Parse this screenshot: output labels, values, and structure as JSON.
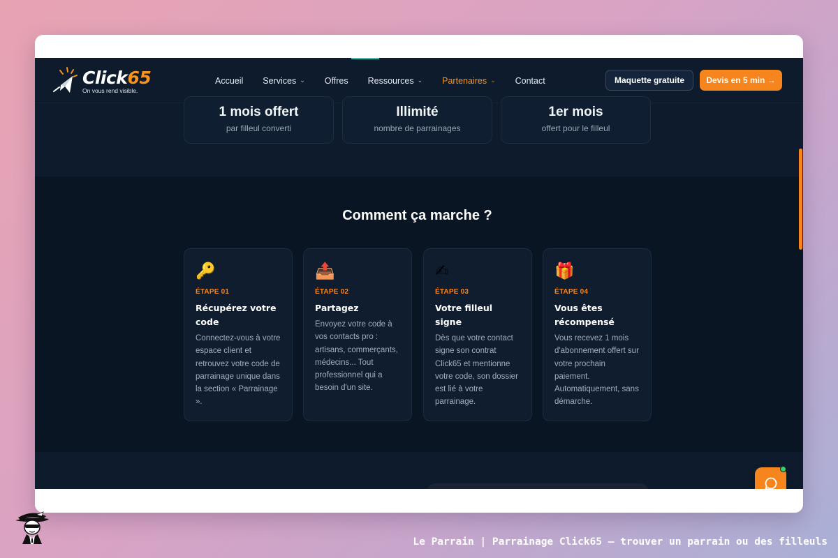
{
  "brand": {
    "logo_text_main": "Click",
    "logo_text_num": "65",
    "tagline": "On vous rend visible."
  },
  "nav": {
    "items": [
      {
        "label": "Accueil",
        "has_dropdown": false,
        "active": false
      },
      {
        "label": "Services",
        "has_dropdown": true,
        "active": false
      },
      {
        "label": "Offres",
        "has_dropdown": false,
        "active": false
      },
      {
        "label": "Ressources",
        "has_dropdown": true,
        "active": false
      },
      {
        "label": "Partenaires",
        "has_dropdown": true,
        "active": true
      },
      {
        "label": "Contact",
        "has_dropdown": false,
        "active": false
      }
    ],
    "cta_secondary": "Maquette gratuite",
    "cta_primary": "Devis en 5 min →"
  },
  "stats": [
    {
      "value": "1 mois offert",
      "sub": "par filleul converti"
    },
    {
      "value": "Illimité",
      "sub": "nombre de parrainages"
    },
    {
      "value": "1er mois",
      "sub": "offert pour le filleul"
    }
  ],
  "how": {
    "title": "Comment ça marche ?",
    "steps": [
      {
        "icon": "key-icon",
        "glyph": "🔑",
        "label": "ÉTAPE 01",
        "title": "Récupérez votre code",
        "desc": "Connectez-vous à votre espace client et retrouvez votre code de parrainage unique dans la section « Parrainage »."
      },
      {
        "icon": "outbox-tray-icon",
        "glyph": "📤",
        "label": "ÉTAPE 02",
        "title": "Partagez",
        "desc": "Envoyez votre code à vos contacts pro : artisans, commerçants, médecins... Tout professionnel qui a besoin d'un site."
      },
      {
        "icon": "writing-hand-icon",
        "glyph": "✍",
        "label": "ÉTAPE 03",
        "title": "Votre filleul signe",
        "desc": "Dès que votre contact signe son contrat Click65 et mentionne votre code, son dossier est lié à votre parrainage."
      },
      {
        "icon": "gift-icon",
        "glyph": "🎁",
        "label": "ÉTAPE 04",
        "title": "Vous êtes récompensé",
        "desc": "Vous recevez 1 mois d'abonnement offert sur votre prochain paiement. Automatiquement, sans démarche."
      }
    ]
  },
  "caption": "Le Parrain | Parrainage Click65 — trouver un parrain ou des filleuls",
  "colors": {
    "accent": "#f7851d",
    "background": "#0b1626",
    "online": "#2dd46b"
  }
}
